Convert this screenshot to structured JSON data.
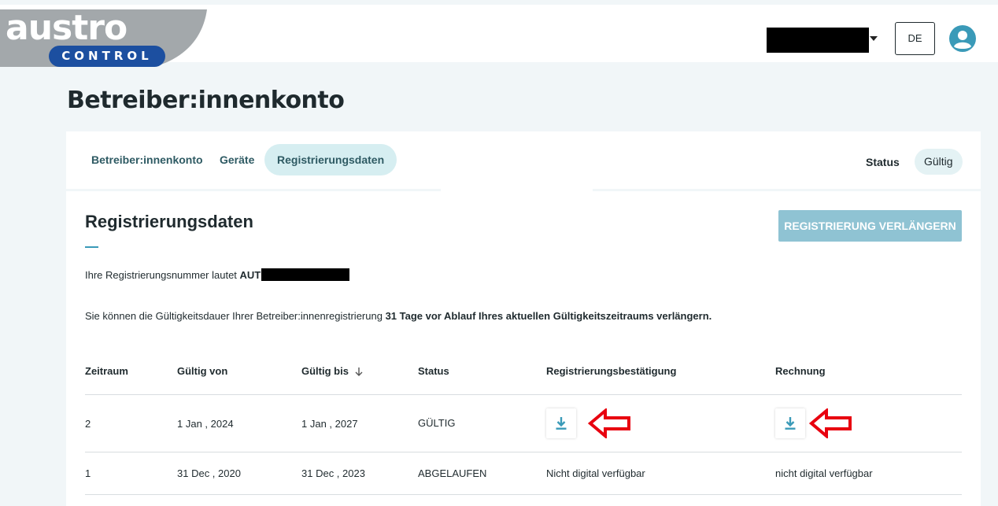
{
  "header": {
    "logo_word": "austro",
    "logo_sub": "CONTROL",
    "language": "DE",
    "icons": {
      "user_menu": "caret-down-icon",
      "avatar": "user-circle-icon"
    }
  },
  "page": {
    "title": "Betreiber:innenkonto"
  },
  "tabs": [
    {
      "label": "Betreiber:innenkonto"
    },
    {
      "label": "Geräte"
    },
    {
      "label": "Registrierungsdaten",
      "active": true
    }
  ],
  "status": {
    "label": "Status",
    "value": "Gültig"
  },
  "section": {
    "title": "Registrierungsdaten",
    "renew_button": "REGISTRIERUNG VERLÄNGERN",
    "reg_prefix": "Ihre Registrierungsnummer lautet",
    "reg_number_visible": "AUT",
    "info_prefix": "Sie können die Gültigkeitsdauer Ihrer Betreiber:innenregistrierung",
    "info_bold": "31 Tage vor Ablauf Ihres aktuellen Gültigkeitszeitraums verlängern."
  },
  "table": {
    "headers": {
      "period": "Zeitraum",
      "valid_from": "Gültig von",
      "valid_to": "Gültig bis",
      "status": "Status",
      "confirmation": "Registrierungsbestätigung",
      "invoice": "Rechnung"
    },
    "rows": [
      {
        "period": "2",
        "valid_from": "1 Jan , 2024",
        "valid_to": "1 Jan , 2027",
        "status": "GÜLTIG",
        "confirmation": "download-icon",
        "invoice": "download-icon"
      },
      {
        "period": "1",
        "valid_from": "31 Dec , 2020",
        "valid_to": "31 Dec , 2023",
        "status": "ABGELAUFEN",
        "confirmation": "Nicht digital verfügbar",
        "invoice": "nicht digital verfügbar"
      }
    ]
  },
  "colors": {
    "accent": "#3a9ab8",
    "tab_active_bg": "#d6eef1",
    "renew_button_bg": "#8fc3d3",
    "logo_blue": "#1c4fa0",
    "logo_gray": "#a3a8ab",
    "annotation_arrow": "#e8000f"
  }
}
